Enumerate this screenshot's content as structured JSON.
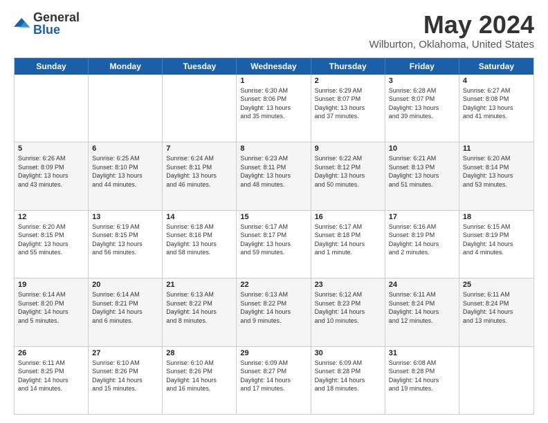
{
  "logo": {
    "general": "General",
    "blue": "Blue"
  },
  "header": {
    "title": "May 2024",
    "subtitle": "Wilburton, Oklahoma, United States"
  },
  "weekdays": [
    "Sunday",
    "Monday",
    "Tuesday",
    "Wednesday",
    "Thursday",
    "Friday",
    "Saturday"
  ],
  "weeks": [
    [
      {
        "date": "",
        "info": ""
      },
      {
        "date": "",
        "info": ""
      },
      {
        "date": "",
        "info": ""
      },
      {
        "date": "1",
        "info": "Sunrise: 6:30 AM\nSunset: 8:06 PM\nDaylight: 13 hours\nand 35 minutes."
      },
      {
        "date": "2",
        "info": "Sunrise: 6:29 AM\nSunset: 8:07 PM\nDaylight: 13 hours\nand 37 minutes."
      },
      {
        "date": "3",
        "info": "Sunrise: 6:28 AM\nSunset: 8:07 PM\nDaylight: 13 hours\nand 39 minutes."
      },
      {
        "date": "4",
        "info": "Sunrise: 6:27 AM\nSunset: 8:08 PM\nDaylight: 13 hours\nand 41 minutes."
      }
    ],
    [
      {
        "date": "5",
        "info": "Sunrise: 6:26 AM\nSunset: 8:09 PM\nDaylight: 13 hours\nand 43 minutes."
      },
      {
        "date": "6",
        "info": "Sunrise: 6:25 AM\nSunset: 8:10 PM\nDaylight: 13 hours\nand 44 minutes."
      },
      {
        "date": "7",
        "info": "Sunrise: 6:24 AM\nSunset: 8:11 PM\nDaylight: 13 hours\nand 46 minutes."
      },
      {
        "date": "8",
        "info": "Sunrise: 6:23 AM\nSunset: 8:11 PM\nDaylight: 13 hours\nand 48 minutes."
      },
      {
        "date": "9",
        "info": "Sunrise: 6:22 AM\nSunset: 8:12 PM\nDaylight: 13 hours\nand 50 minutes."
      },
      {
        "date": "10",
        "info": "Sunrise: 6:21 AM\nSunset: 8:13 PM\nDaylight: 13 hours\nand 51 minutes."
      },
      {
        "date": "11",
        "info": "Sunrise: 6:20 AM\nSunset: 8:14 PM\nDaylight: 13 hours\nand 53 minutes."
      }
    ],
    [
      {
        "date": "12",
        "info": "Sunrise: 6:20 AM\nSunset: 8:15 PM\nDaylight: 13 hours\nand 55 minutes."
      },
      {
        "date": "13",
        "info": "Sunrise: 6:19 AM\nSunset: 8:15 PM\nDaylight: 13 hours\nand 56 minutes."
      },
      {
        "date": "14",
        "info": "Sunrise: 6:18 AM\nSunset: 8:16 PM\nDaylight: 13 hours\nand 58 minutes."
      },
      {
        "date": "15",
        "info": "Sunrise: 6:17 AM\nSunset: 8:17 PM\nDaylight: 13 hours\nand 59 minutes."
      },
      {
        "date": "16",
        "info": "Sunrise: 6:17 AM\nSunset: 8:18 PM\nDaylight: 14 hours\nand 1 minute."
      },
      {
        "date": "17",
        "info": "Sunrise: 6:16 AM\nSunset: 8:19 PM\nDaylight: 14 hours\nand 2 minutes."
      },
      {
        "date": "18",
        "info": "Sunrise: 6:15 AM\nSunset: 8:19 PM\nDaylight: 14 hours\nand 4 minutes."
      }
    ],
    [
      {
        "date": "19",
        "info": "Sunrise: 6:14 AM\nSunset: 8:20 PM\nDaylight: 14 hours\nand 5 minutes."
      },
      {
        "date": "20",
        "info": "Sunrise: 6:14 AM\nSunset: 8:21 PM\nDaylight: 14 hours\nand 6 minutes."
      },
      {
        "date": "21",
        "info": "Sunrise: 6:13 AM\nSunset: 8:22 PM\nDaylight: 14 hours\nand 8 minutes."
      },
      {
        "date": "22",
        "info": "Sunrise: 6:13 AM\nSunset: 8:22 PM\nDaylight: 14 hours\nand 9 minutes."
      },
      {
        "date": "23",
        "info": "Sunrise: 6:12 AM\nSunset: 8:23 PM\nDaylight: 14 hours\nand 10 minutes."
      },
      {
        "date": "24",
        "info": "Sunrise: 6:11 AM\nSunset: 8:24 PM\nDaylight: 14 hours\nand 12 minutes."
      },
      {
        "date": "25",
        "info": "Sunrise: 6:11 AM\nSunset: 8:24 PM\nDaylight: 14 hours\nand 13 minutes."
      }
    ],
    [
      {
        "date": "26",
        "info": "Sunrise: 6:11 AM\nSunset: 8:25 PM\nDaylight: 14 hours\nand 14 minutes."
      },
      {
        "date": "27",
        "info": "Sunrise: 6:10 AM\nSunset: 8:26 PM\nDaylight: 14 hours\nand 15 minutes."
      },
      {
        "date": "28",
        "info": "Sunrise: 6:10 AM\nSunset: 8:26 PM\nDaylight: 14 hours\nand 16 minutes."
      },
      {
        "date": "29",
        "info": "Sunrise: 6:09 AM\nSunset: 8:27 PM\nDaylight: 14 hours\nand 17 minutes."
      },
      {
        "date": "30",
        "info": "Sunrise: 6:09 AM\nSunset: 8:28 PM\nDaylight: 14 hours\nand 18 minutes."
      },
      {
        "date": "31",
        "info": "Sunrise: 6:08 AM\nSunset: 8:28 PM\nDaylight: 14 hours\nand 19 minutes."
      },
      {
        "date": "",
        "info": ""
      }
    ]
  ]
}
